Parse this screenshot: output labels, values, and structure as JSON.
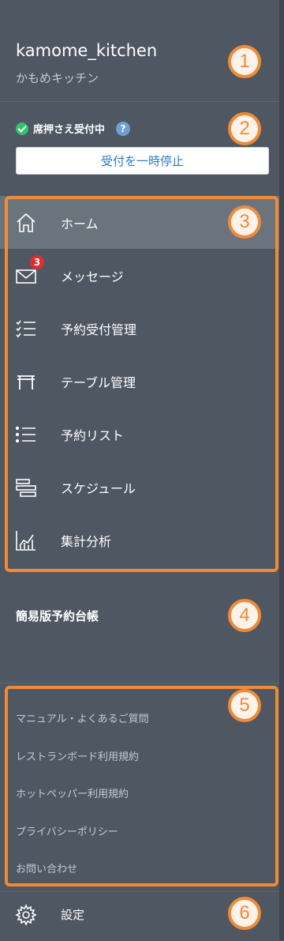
{
  "account": {
    "id": "kamome_kitchen",
    "name": "かもめキッチン"
  },
  "status": {
    "text": "席押さえ受付中",
    "help_icon": "?",
    "pause_label": "受付を一時停止"
  },
  "nav": [
    {
      "label": "ホーム",
      "icon": "home-icon",
      "active": true
    },
    {
      "label": "メッセージ",
      "icon": "envelope-icon",
      "badge": "3"
    },
    {
      "label": "予約受付管理",
      "icon": "checklist-icon"
    },
    {
      "label": "テーブル管理",
      "icon": "table-icon"
    },
    {
      "label": "予約リスト",
      "icon": "list-icon"
    },
    {
      "label": "スケジュール",
      "icon": "schedule-icon"
    },
    {
      "label": "集計分析",
      "icon": "analytics-icon"
    }
  ],
  "simple_ledger": "簡易版予約台帳",
  "links": [
    "マニュアル・よくあるご質問",
    "レストランボード利用規約",
    "ホットペッパー利用規約",
    "プライバシーポリシー",
    "お問い合わせ"
  ],
  "settings": {
    "label": "設定"
  },
  "annotations": [
    "1",
    "2",
    "3",
    "4",
    "5",
    "6"
  ],
  "colors": {
    "accent": "#f08b38",
    "background": "#4f5762",
    "active": "#6b737d",
    "link": "#2b7ac3"
  }
}
